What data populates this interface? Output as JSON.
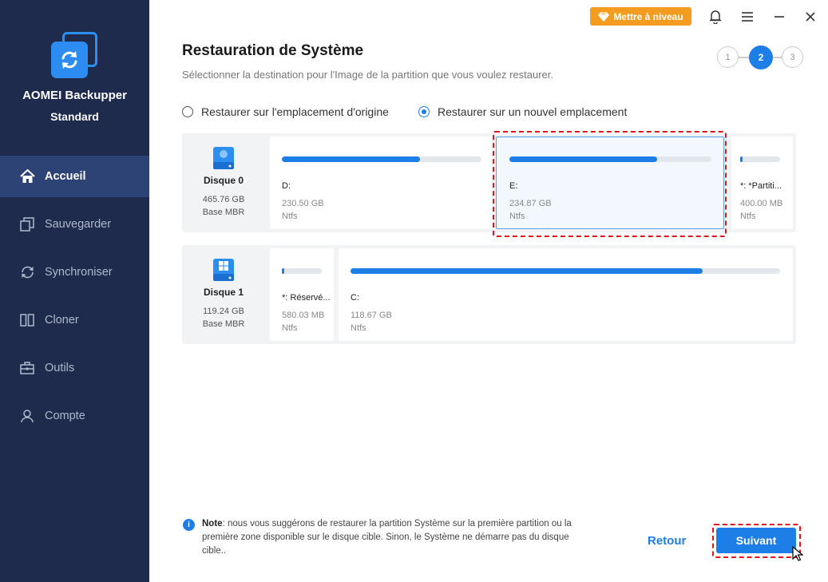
{
  "app": {
    "name": "AOMEI Backupper",
    "edition": "Standard"
  },
  "sidebar": {
    "items": [
      {
        "label": "Accueil",
        "icon": "home-icon",
        "active": true
      },
      {
        "label": "Sauvegarder",
        "icon": "backup-icon",
        "active": false
      },
      {
        "label": "Synchroniser",
        "icon": "sync-icon",
        "active": false
      },
      {
        "label": "Cloner",
        "icon": "clone-icon",
        "active": false
      },
      {
        "label": "Outils",
        "icon": "toolbox-icon",
        "active": false
      },
      {
        "label": "Compte",
        "icon": "user-icon",
        "active": false
      }
    ]
  },
  "titlebar": {
    "upgrade_label": "Mettre à niveau"
  },
  "page": {
    "title": "Restauration de Système",
    "subtitle": "Sélectionner la destination pour l'Image de la partition que vous voulez restaurer.",
    "steps": [
      "1",
      "2",
      "3"
    ],
    "active_step": 2
  },
  "options": {
    "original": "Restaurer sur l'emplacement d'origine",
    "new": "Restaurer sur un nouvel emplacement",
    "selected": "new"
  },
  "disks": [
    {
      "name": "Disque 0",
      "size": "465.76 GB",
      "type": "Base MBR",
      "partitions": [
        {
          "label": "D:",
          "size": "230.50 GB",
          "fs": "Ntfs",
          "used": 0.69
        },
        {
          "label": "E:",
          "size": "234.87 GB",
          "fs": "Ntfs",
          "used": 0.73,
          "selected": true
        },
        {
          "label": "*: *Partiti...",
          "size": "400.00 MB",
          "fs": "Ntfs",
          "used": 0.06
        }
      ]
    },
    {
      "name": "Disque 1",
      "size": "119.24 GB",
      "type": "Base MBR",
      "partitions": [
        {
          "label": "*: Réservé...",
          "size": "580.03 MB",
          "fs": "Ntfs",
          "used": 0.06
        },
        {
          "label": "C:",
          "size": "118.67 GB",
          "fs": "Ntfs",
          "used": 0.82
        }
      ]
    }
  ],
  "note": {
    "bold": "Note",
    "text": ": nous vous suggérons de restaurer la partition Système sur la première partition ou la première zone disponible sur le disque cible. Sinon, le Système ne démarre pas du disque cible.."
  },
  "buttons": {
    "back": "Retour",
    "next": "Suivant"
  },
  "colors": {
    "accent": "#1e7ee8",
    "sidebar": "#1e2b4d",
    "upgrade": "#f39c1f",
    "highlight": "#e0121b"
  }
}
